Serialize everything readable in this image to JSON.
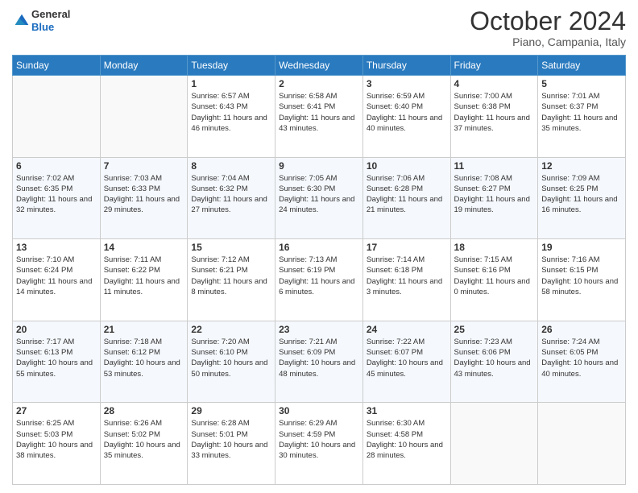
{
  "logo": {
    "general": "General",
    "blue": "Blue"
  },
  "header": {
    "month": "October 2024",
    "location": "Piano, Campania, Italy"
  },
  "weekdays": [
    "Sunday",
    "Monday",
    "Tuesday",
    "Wednesday",
    "Thursday",
    "Friday",
    "Saturday"
  ],
  "weeks": [
    [
      {
        "day": "",
        "sunrise": "",
        "sunset": "",
        "daylight": ""
      },
      {
        "day": "",
        "sunrise": "",
        "sunset": "",
        "daylight": ""
      },
      {
        "day": "1",
        "sunrise": "Sunrise: 6:57 AM",
        "sunset": "Sunset: 6:43 PM",
        "daylight": "Daylight: 11 hours and 46 minutes."
      },
      {
        "day": "2",
        "sunrise": "Sunrise: 6:58 AM",
        "sunset": "Sunset: 6:41 PM",
        "daylight": "Daylight: 11 hours and 43 minutes."
      },
      {
        "day": "3",
        "sunrise": "Sunrise: 6:59 AM",
        "sunset": "Sunset: 6:40 PM",
        "daylight": "Daylight: 11 hours and 40 minutes."
      },
      {
        "day": "4",
        "sunrise": "Sunrise: 7:00 AM",
        "sunset": "Sunset: 6:38 PM",
        "daylight": "Daylight: 11 hours and 37 minutes."
      },
      {
        "day": "5",
        "sunrise": "Sunrise: 7:01 AM",
        "sunset": "Sunset: 6:37 PM",
        "daylight": "Daylight: 11 hours and 35 minutes."
      }
    ],
    [
      {
        "day": "6",
        "sunrise": "Sunrise: 7:02 AM",
        "sunset": "Sunset: 6:35 PM",
        "daylight": "Daylight: 11 hours and 32 minutes."
      },
      {
        "day": "7",
        "sunrise": "Sunrise: 7:03 AM",
        "sunset": "Sunset: 6:33 PM",
        "daylight": "Daylight: 11 hours and 29 minutes."
      },
      {
        "day": "8",
        "sunrise": "Sunrise: 7:04 AM",
        "sunset": "Sunset: 6:32 PM",
        "daylight": "Daylight: 11 hours and 27 minutes."
      },
      {
        "day": "9",
        "sunrise": "Sunrise: 7:05 AM",
        "sunset": "Sunset: 6:30 PM",
        "daylight": "Daylight: 11 hours and 24 minutes."
      },
      {
        "day": "10",
        "sunrise": "Sunrise: 7:06 AM",
        "sunset": "Sunset: 6:28 PM",
        "daylight": "Daylight: 11 hours and 21 minutes."
      },
      {
        "day": "11",
        "sunrise": "Sunrise: 7:08 AM",
        "sunset": "Sunset: 6:27 PM",
        "daylight": "Daylight: 11 hours and 19 minutes."
      },
      {
        "day": "12",
        "sunrise": "Sunrise: 7:09 AM",
        "sunset": "Sunset: 6:25 PM",
        "daylight": "Daylight: 11 hours and 16 minutes."
      }
    ],
    [
      {
        "day": "13",
        "sunrise": "Sunrise: 7:10 AM",
        "sunset": "Sunset: 6:24 PM",
        "daylight": "Daylight: 11 hours and 14 minutes."
      },
      {
        "day": "14",
        "sunrise": "Sunrise: 7:11 AM",
        "sunset": "Sunset: 6:22 PM",
        "daylight": "Daylight: 11 hours and 11 minutes."
      },
      {
        "day": "15",
        "sunrise": "Sunrise: 7:12 AM",
        "sunset": "Sunset: 6:21 PM",
        "daylight": "Daylight: 11 hours and 8 minutes."
      },
      {
        "day": "16",
        "sunrise": "Sunrise: 7:13 AM",
        "sunset": "Sunset: 6:19 PM",
        "daylight": "Daylight: 11 hours and 6 minutes."
      },
      {
        "day": "17",
        "sunrise": "Sunrise: 7:14 AM",
        "sunset": "Sunset: 6:18 PM",
        "daylight": "Daylight: 11 hours and 3 minutes."
      },
      {
        "day": "18",
        "sunrise": "Sunrise: 7:15 AM",
        "sunset": "Sunset: 6:16 PM",
        "daylight": "Daylight: 11 hours and 0 minutes."
      },
      {
        "day": "19",
        "sunrise": "Sunrise: 7:16 AM",
        "sunset": "Sunset: 6:15 PM",
        "daylight": "Daylight: 10 hours and 58 minutes."
      }
    ],
    [
      {
        "day": "20",
        "sunrise": "Sunrise: 7:17 AM",
        "sunset": "Sunset: 6:13 PM",
        "daylight": "Daylight: 10 hours and 55 minutes."
      },
      {
        "day": "21",
        "sunrise": "Sunrise: 7:18 AM",
        "sunset": "Sunset: 6:12 PM",
        "daylight": "Daylight: 10 hours and 53 minutes."
      },
      {
        "day": "22",
        "sunrise": "Sunrise: 7:20 AM",
        "sunset": "Sunset: 6:10 PM",
        "daylight": "Daylight: 10 hours and 50 minutes."
      },
      {
        "day": "23",
        "sunrise": "Sunrise: 7:21 AM",
        "sunset": "Sunset: 6:09 PM",
        "daylight": "Daylight: 10 hours and 48 minutes."
      },
      {
        "day": "24",
        "sunrise": "Sunrise: 7:22 AM",
        "sunset": "Sunset: 6:07 PM",
        "daylight": "Daylight: 10 hours and 45 minutes."
      },
      {
        "day": "25",
        "sunrise": "Sunrise: 7:23 AM",
        "sunset": "Sunset: 6:06 PM",
        "daylight": "Daylight: 10 hours and 43 minutes."
      },
      {
        "day": "26",
        "sunrise": "Sunrise: 7:24 AM",
        "sunset": "Sunset: 6:05 PM",
        "daylight": "Daylight: 10 hours and 40 minutes."
      }
    ],
    [
      {
        "day": "27",
        "sunrise": "Sunrise: 6:25 AM",
        "sunset": "Sunset: 5:03 PM",
        "daylight": "Daylight: 10 hours and 38 minutes."
      },
      {
        "day": "28",
        "sunrise": "Sunrise: 6:26 AM",
        "sunset": "Sunset: 5:02 PM",
        "daylight": "Daylight: 10 hours and 35 minutes."
      },
      {
        "day": "29",
        "sunrise": "Sunrise: 6:28 AM",
        "sunset": "Sunset: 5:01 PM",
        "daylight": "Daylight: 10 hours and 33 minutes."
      },
      {
        "day": "30",
        "sunrise": "Sunrise: 6:29 AM",
        "sunset": "Sunset: 4:59 PM",
        "daylight": "Daylight: 10 hours and 30 minutes."
      },
      {
        "day": "31",
        "sunrise": "Sunrise: 6:30 AM",
        "sunset": "Sunset: 4:58 PM",
        "daylight": "Daylight: 10 hours and 28 minutes."
      },
      {
        "day": "",
        "sunrise": "",
        "sunset": "",
        "daylight": ""
      },
      {
        "day": "",
        "sunrise": "",
        "sunset": "",
        "daylight": ""
      }
    ]
  ]
}
